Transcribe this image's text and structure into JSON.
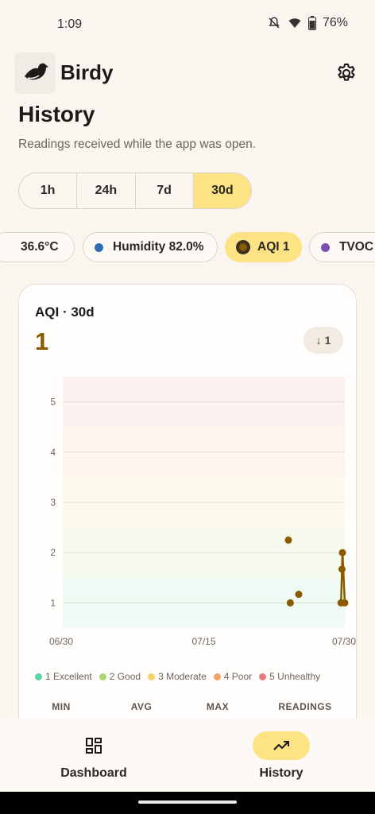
{
  "status": {
    "time": "1:09",
    "battery": "76%"
  },
  "app": {
    "name": "Birdy"
  },
  "page": {
    "title": "History",
    "subtitle": "Readings received while the app was open."
  },
  "ranges": [
    {
      "label": "1h",
      "active": false
    },
    {
      "label": "24h",
      "active": false
    },
    {
      "label": "7d",
      "active": false
    },
    {
      "label": "30d",
      "active": true
    }
  ],
  "chips": {
    "temperature": "36.6°C",
    "humidity": "Humidity 82.0%",
    "aqi": "AQI 1",
    "tvoc": "TVOC"
  },
  "colors": {
    "accent": "#fde383",
    "series": "#8a5a00",
    "humidity_dot": "#2f6db0",
    "tvoc_dot": "#7d4fb0"
  },
  "card": {
    "title": "AQI · 30d",
    "value": "1",
    "badge_value": "1"
  },
  "chart_data": {
    "type": "scatter",
    "title": "",
    "xlabel": "",
    "ylabel": "",
    "ylim": [
      0.5,
      5.5
    ],
    "yticks": [
      "1",
      "2",
      "3",
      "4",
      "5"
    ],
    "xticks": [
      "06/30",
      "07/15",
      "07/30"
    ],
    "x_domain": [
      "06/30",
      "07/30"
    ],
    "bands": [
      {
        "name": "Excellent",
        "from": 0.5,
        "to": 1.5,
        "color": "#5dd3a6"
      },
      {
        "name": "Good",
        "from": 1.5,
        "to": 2.5,
        "color": "#a8d86e"
      },
      {
        "name": "Moderate",
        "from": 2.5,
        "to": 3.5,
        "color": "#f6d06a"
      },
      {
        "name": "Poor",
        "from": 3.5,
        "to": 4.5,
        "color": "#f0a36a"
      },
      {
        "name": "Unhealthy",
        "from": 4.5,
        "to": 5.5,
        "color": "#e87c7c"
      }
    ],
    "series": [
      {
        "points": [
          {
            "x": "07/24",
            "y": 2.25
          },
          {
            "x": "07/24.2",
            "y": 1.0
          },
          {
            "x": "07/25.1",
            "y": 1.17
          },
          {
            "x": "07/29.6",
            "y": 1.0
          },
          {
            "x": "07/29.7",
            "y": 1.67
          },
          {
            "x": "07/29.75",
            "y": 2.0
          },
          {
            "x": "07/30",
            "y": 1.0
          }
        ]
      }
    ]
  },
  "legend": [
    "1 Excellent",
    "2 Good",
    "3 Moderate",
    "4 Poor",
    "5 Unhealthy"
  ],
  "stats_headers": [
    "MIN",
    "AVG",
    "MAX",
    "READINGS"
  ],
  "nav": {
    "dashboard": "Dashboard",
    "history": "History"
  }
}
